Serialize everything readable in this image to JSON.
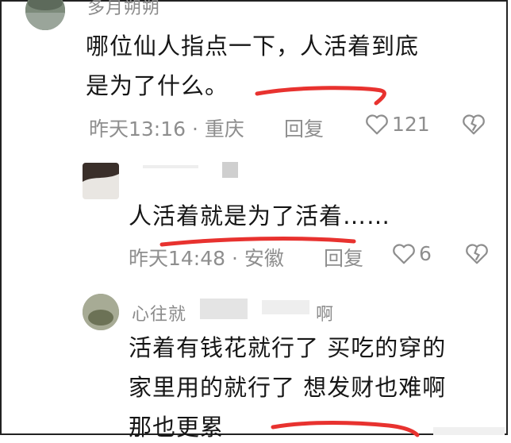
{
  "comments": [
    {
      "username": "多月朔朔",
      "lines": [
        "哪位仙人指点一下，人活着到底",
        "是为了什么。"
      ],
      "time_location": "昨天13:16 · 重庆",
      "reply_label": "回复",
      "likes": "121"
    },
    {
      "username": "",
      "lines": [
        "人活着就是为了活着……"
      ],
      "time_location": "昨天14:48 · 安徽",
      "reply_label": "回复",
      "likes": "6"
    },
    {
      "username": "心往就",
      "username_suffix": "啊",
      "lines": [
        "活着有钱花就行了 买吃的穿的",
        "家里用的就行了 想发财也难啊",
        "那也更累"
      ]
    }
  ],
  "colors": {
    "highlight": "#e8322f",
    "meta": "#8e8e8e",
    "text": "#161616"
  },
  "icons": {
    "like": "heart-outline-icon",
    "dislike": "broken-heart-icon"
  }
}
